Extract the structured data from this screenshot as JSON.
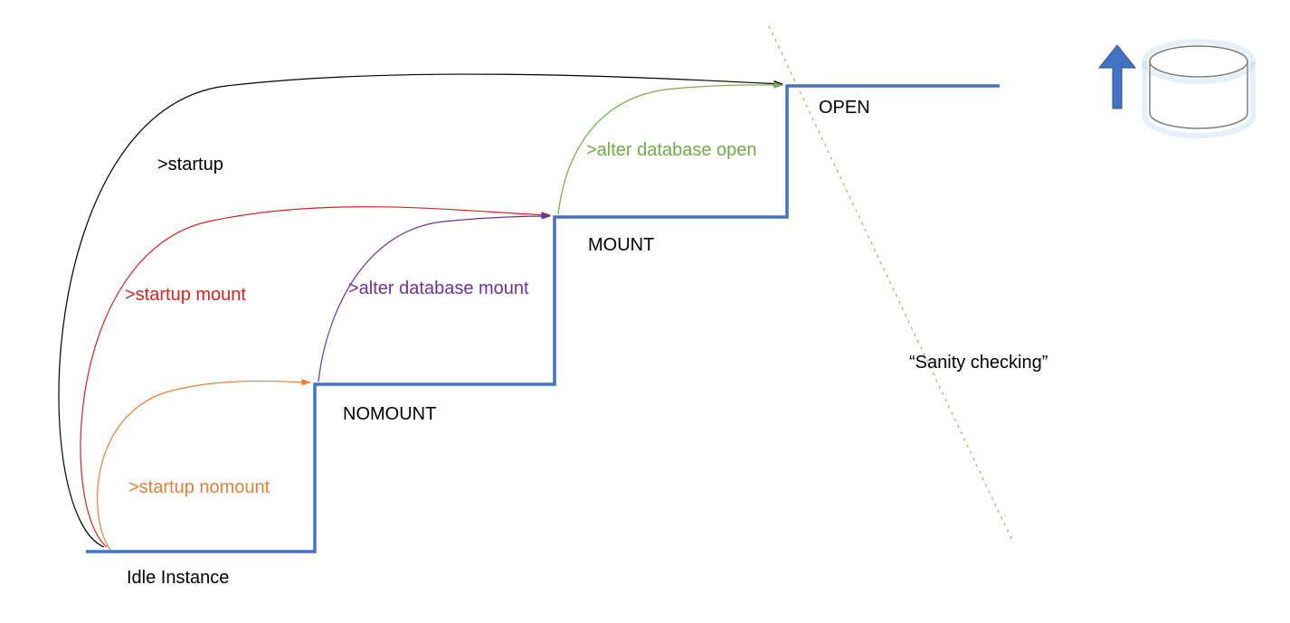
{
  "states": {
    "idle": "Idle Instance",
    "nomount": "NOMOUNT",
    "mount": "MOUNT",
    "open": "OPEN"
  },
  "commands": {
    "startup": ">startup",
    "startup_mount": ">startup mount",
    "startup_nomount": ">startup nomount",
    "alter_mount": ">alter database mount",
    "alter_open": ">alter database open"
  },
  "annotations": {
    "sanity": "“Sanity checking”"
  },
  "colors": {
    "staircase": "#4472c4",
    "startup": "#000000",
    "startup_mount": "#e01f1f",
    "startup_nomount": "#ed7d31",
    "alter_mount": "#7030a0",
    "alter_open": "#70ad47",
    "sanity_line": "#70ad47",
    "cylinder_fill": "#ffffff",
    "cylinder_stroke": "#4472c4",
    "arrow": "#4472c4"
  }
}
